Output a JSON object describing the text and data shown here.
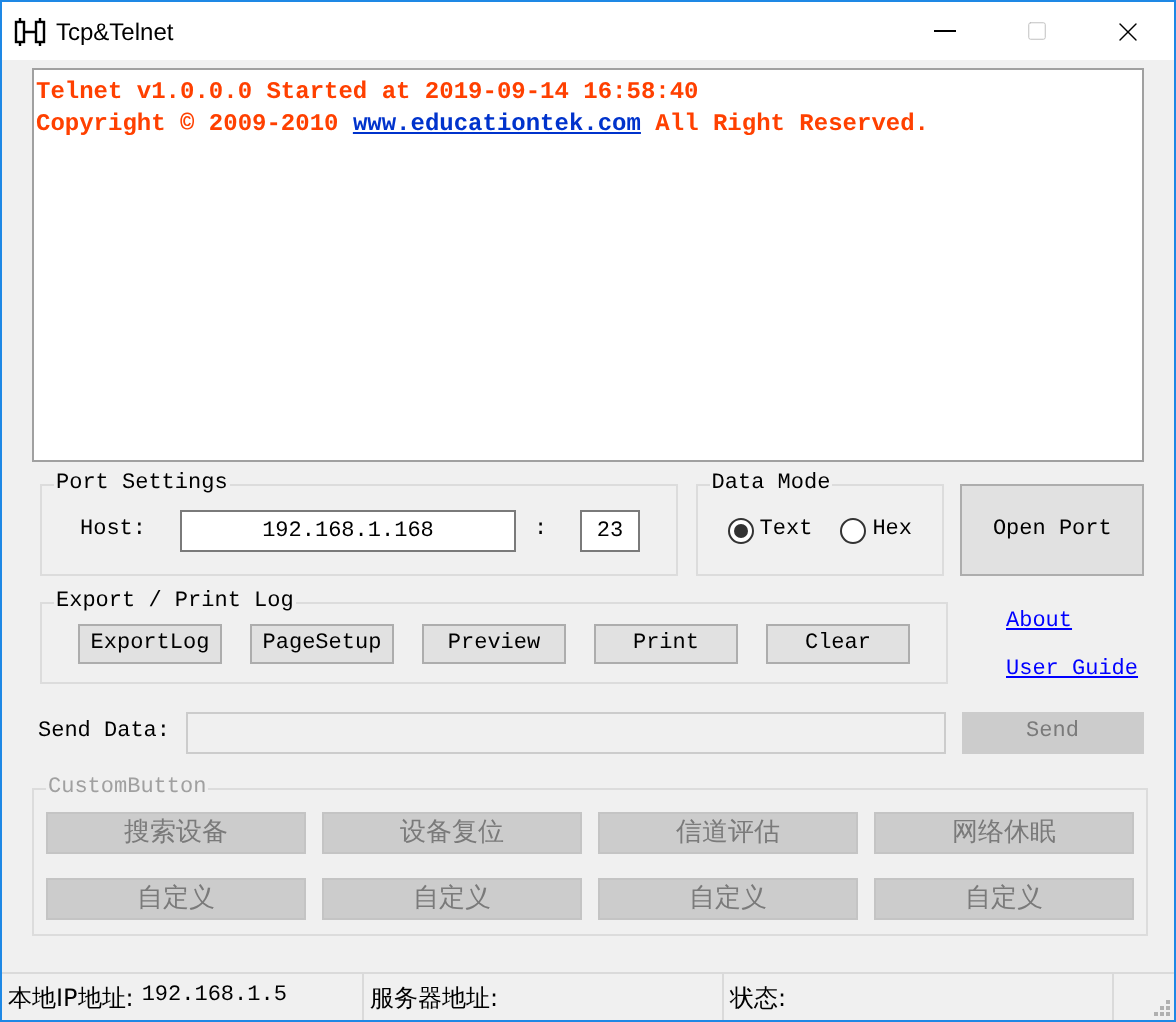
{
  "window": {
    "title": "Tcp&Telnet"
  },
  "log": {
    "lines": [
      {
        "kind": "plain",
        "text": "Telnet v1.0.0.0 Started at 2019-09-14 16:58:40"
      },
      {
        "kind": "link",
        "before": "Copyright © 2009-2010",
        "link": "www.educationtek.com",
        "after": "All Right Reserved."
      }
    ]
  },
  "port_settings": {
    "title": "Port Settings",
    "host_label": "Host:",
    "host": "192.168.1.168",
    "separator": ":",
    "port": "23"
  },
  "data_mode": {
    "title": "Data Mode",
    "options": [
      {
        "label": "Text",
        "selected": true
      },
      {
        "label": "Hex",
        "selected": false
      }
    ]
  },
  "open_port_button": "Open Port",
  "export": {
    "title": "Export / Print Log",
    "buttons": [
      "ExportLog",
      "PageSetup",
      "Preview",
      "Print",
      "Clear"
    ]
  },
  "links": [
    "About",
    "User Guide"
  ],
  "send": {
    "label": "Send Data:",
    "button": "Send",
    "disabled": true
  },
  "custom": {
    "title": "CustomButton",
    "buttons": [
      {
        "label": "搜索设备",
        "disabled": true
      },
      {
        "label": "设备复位",
        "disabled": true
      },
      {
        "label": "信道评估",
        "disabled": true
      },
      {
        "label": "网络休眠",
        "disabled": true
      },
      {
        "label": "自定义",
        "disabled": true
      },
      {
        "label": "自定义",
        "disabled": true
      },
      {
        "label": "自定义",
        "disabled": true
      },
      {
        "label": "自定义",
        "disabled": true
      }
    ]
  },
  "status_bar": [
    {
      "label": "本地IP地址:",
      "value": "192.168.1.5"
    },
    {
      "label": "服务器地址:"
    },
    {
      "label": "状态:"
    }
  ]
}
